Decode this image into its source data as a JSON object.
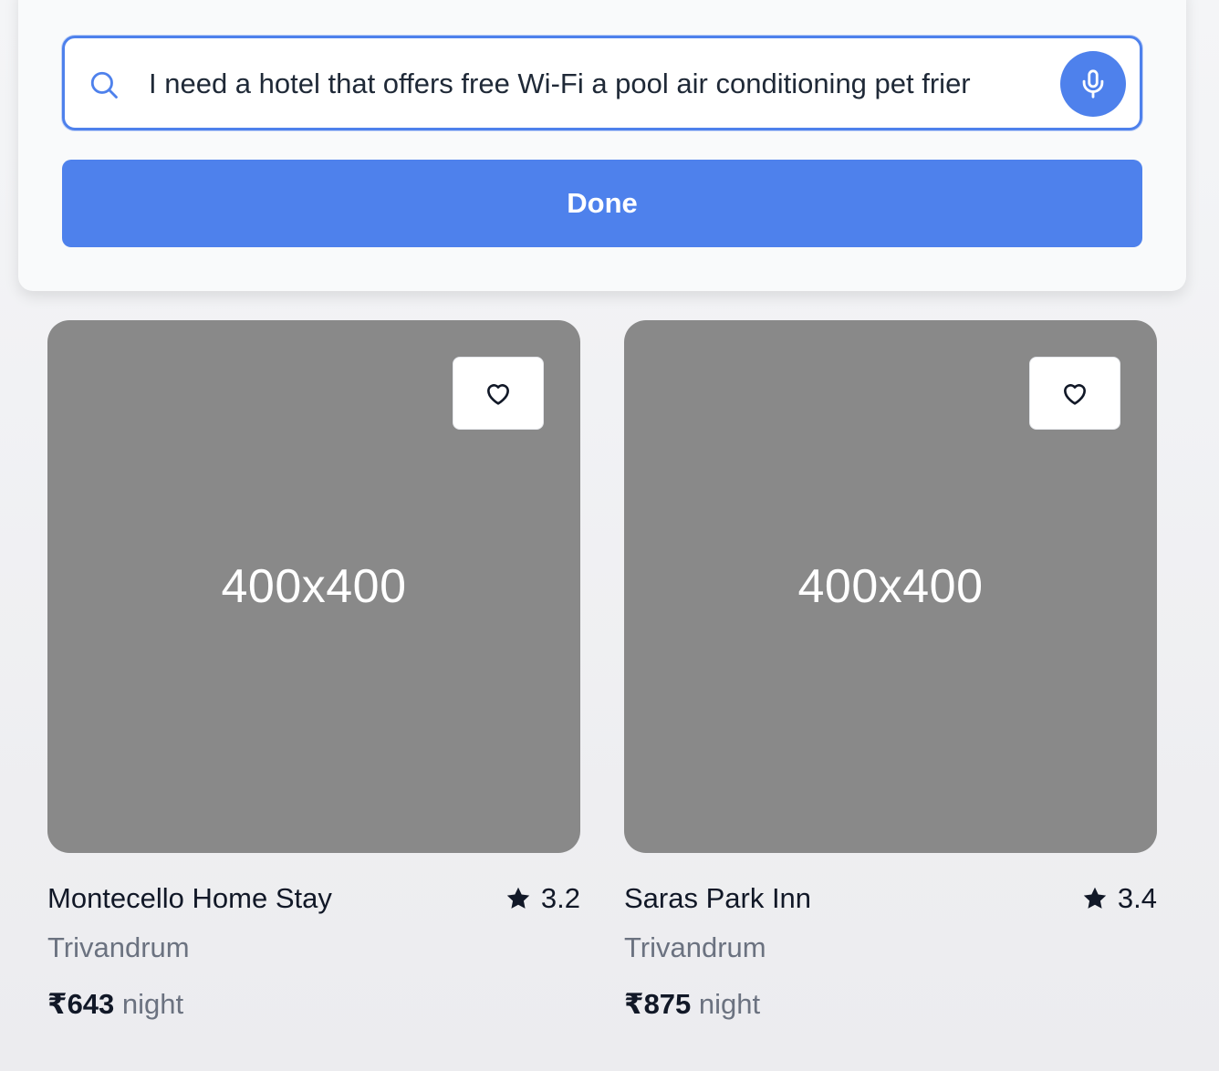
{
  "search": {
    "value": "I need a hotel that offers free Wi-Fi a pool air conditioning pet frier",
    "search_icon": "search-icon",
    "mic_icon": "microphone-icon"
  },
  "done_button": {
    "label": "Done"
  },
  "colors": {
    "accent": "#4e81ec",
    "placeholder_image": "#898989",
    "muted_text": "#6b7280"
  },
  "listings": [
    {
      "image_label": "400x400",
      "name": "Montecello Home Stay",
      "rating": "3.2",
      "location": "Trivandrum",
      "price": "₹643",
      "price_unit": "night"
    },
    {
      "image_label": "400x400",
      "name": "Saras Park Inn",
      "rating": "3.4",
      "location": "Trivandrum",
      "price": "₹875",
      "price_unit": "night"
    }
  ]
}
